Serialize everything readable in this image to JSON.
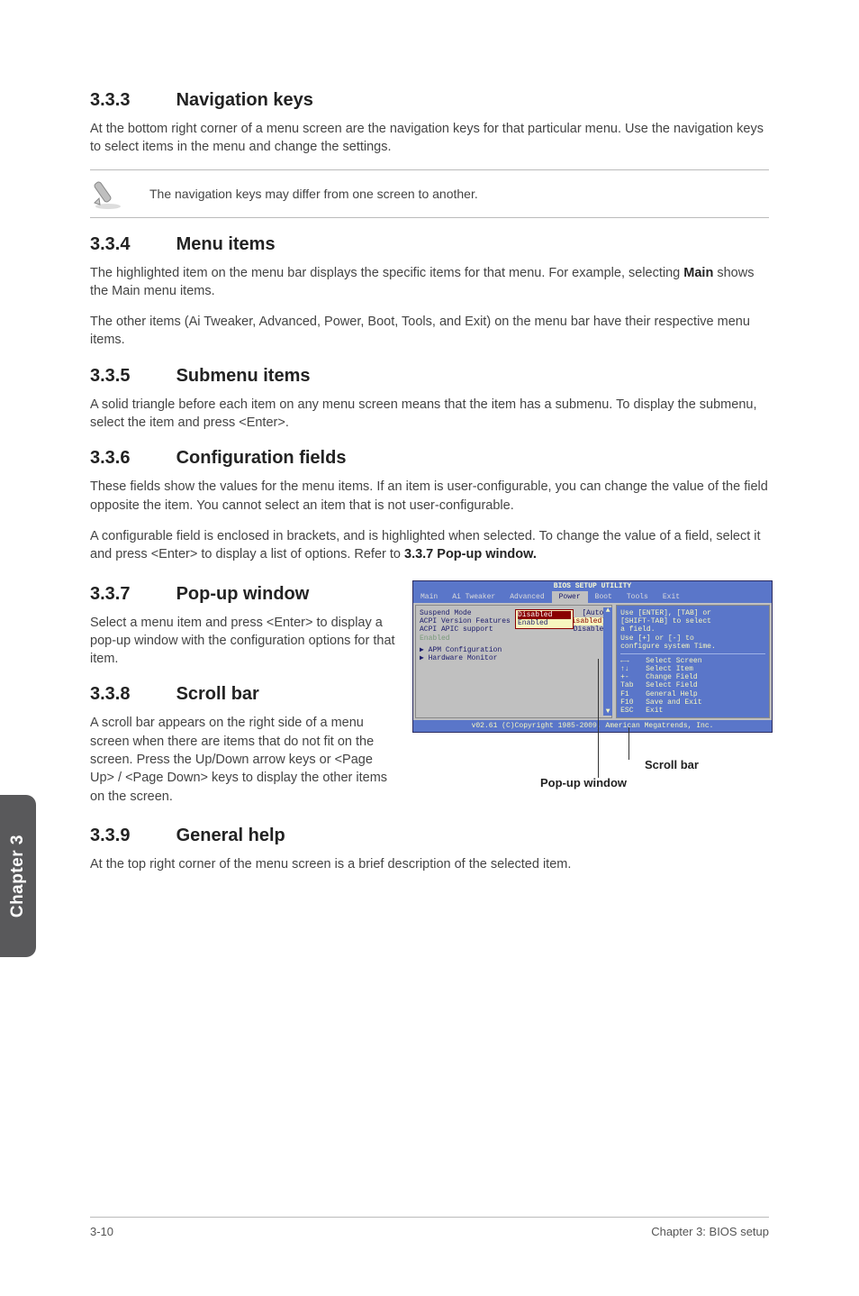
{
  "sections": {
    "s333": {
      "num": "3.3.3",
      "title": "Navigation keys",
      "p1": "At the bottom right corner of a menu screen are the navigation keys for that particular menu. Use the navigation keys to select items in the menu and change the settings."
    },
    "note333": "The navigation keys may differ from one screen to another.",
    "s334": {
      "num": "3.3.4",
      "title": "Menu items",
      "p1_a": "The highlighted item on the menu bar displays the specific items for that menu. For example, selecting ",
      "p1_b": "Main",
      "p1_c": " shows the Main menu items.",
      "p2": "The other items (Ai Tweaker, Advanced, Power, Boot, Tools, and Exit) on the menu bar have their respective menu items."
    },
    "s335": {
      "num": "3.3.5",
      "title": "Submenu items",
      "p1": "A solid triangle before each item on any menu screen means that the item has a submenu. To display the submenu, select the item and press <Enter>."
    },
    "s336": {
      "num": "3.3.6",
      "title": "Configuration fields",
      "p1": "These fields show the values for the menu items. If an item is user-configurable, you can change the value of the field opposite the item. You cannot select an item that is not user-configurable.",
      "p2_a": "A configurable field is enclosed in brackets, and is highlighted when selected. To change the value of a field, select it and press <Enter> to display a list of options. Refer to ",
      "p2_b": "3.3.7 Pop-up window."
    },
    "s337": {
      "num": "3.3.7",
      "title": "Pop-up window",
      "p1": "Select a menu item and press <Enter> to display a pop-up window with the configuration options for that item."
    },
    "s338": {
      "num": "3.3.8",
      "title": "Scroll bar",
      "p1": "A scroll bar appears on the right side of a menu screen when there are items that do not fit on the screen. Press the Up/Down arrow keys or <Page Up> / <Page Down> keys to display the other items on the screen."
    },
    "s339": {
      "num": "3.3.9",
      "title": "General help",
      "p1": "At the top right corner of the menu screen is a brief description of the selected item."
    }
  },
  "tab": "Chapter 3",
  "footer": {
    "left": "3-10",
    "right": "Chapter 3: BIOS setup"
  },
  "bios": {
    "title": "BIOS SETUP UTILITY",
    "tabs": [
      "Main",
      "Ai Tweaker",
      "Advanced",
      "Power",
      "Boot",
      "Tools",
      "Exit"
    ],
    "active_tab": "Power",
    "left_rows": [
      {
        "label": "Suspend Mode",
        "val": "[Auto]"
      },
      {
        "label": "ACPI Version Features",
        "val": "[Disabled]",
        "selected": true
      },
      {
        "label": "ACPI APIC support",
        "val": "Disabled"
      }
    ],
    "popup_opts": [
      "Disabled",
      "Enabled"
    ],
    "popup_extra": "Enabled",
    "sub_rows": [
      "APM Configuration",
      "Hardware Monitor"
    ],
    "help_top": [
      "Use [ENTER], [TAB] or",
      "[SHIFT-TAB] to select",
      "a field.",
      "",
      "Use [+] or [-] to",
      "configure system Time."
    ],
    "keyrows": [
      {
        "k": "←→",
        "d": "Select Screen"
      },
      {
        "k": "↑↓",
        "d": "Select Item"
      },
      {
        "k": "+-",
        "d": "Change Field"
      },
      {
        "k": "Tab",
        "d": "Select Field"
      },
      {
        "k": "F1",
        "d": "General Help"
      },
      {
        "k": "F10",
        "d": "Save and Exit"
      },
      {
        "k": "ESC",
        "d": "Exit"
      }
    ],
    "footer": "v02.61 (C)Copyright 1985-2009, American Megatrends, Inc."
  },
  "labels": {
    "scroll": "Scroll bar",
    "popup": "Pop-up window"
  }
}
